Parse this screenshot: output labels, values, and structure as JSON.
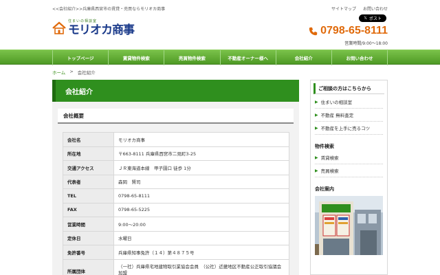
{
  "header": {
    "tagline": "<<会社紹介>>兵庫県西宮市の賃貸・売買ならモリオカ商事",
    "logo_sub": "住まいの相談室",
    "logo_main": "モリオカ商事",
    "links": [
      "サイトマップ",
      "お問い合わせ"
    ],
    "x_post": "ポスト",
    "phone": "0798-65-8111",
    "hours": "営業時間/9:00～18:00",
    "colors": {
      "accent_orange": "#e06a0b",
      "brand_green": "#2f8f1e"
    }
  },
  "nav": {
    "items": [
      "トップページ",
      "賃貸物件検索",
      "売買物件検索",
      "不動産オーナー様へ",
      "会社紹介",
      "お問い合わせ"
    ]
  },
  "breadcrumb": {
    "home": "ホーム",
    "sep": ">",
    "current": "会社紹介"
  },
  "main": {
    "title": "会社紹介",
    "section_title": "会社概要",
    "rows": [
      {
        "label": "会社名",
        "value": "モリオカ商事"
      },
      {
        "label": "所在地",
        "value": "〒663-8111 兵庫県西宮市二見町3-25"
      },
      {
        "label": "交通アクセス",
        "value": "ＪＲ東海道本線　甲子園口 徒歩 1分"
      },
      {
        "label": "代表者",
        "value": "森岡　賢司"
      },
      {
        "label": "TEL",
        "value": "0798-65-8111"
      },
      {
        "label": "FAX",
        "value": "0798-65-5225"
      },
      {
        "label": "営業時間",
        "value": "9:00～20:00"
      },
      {
        "label": "定休日",
        "value": "水曜日"
      },
      {
        "label": "免許番号",
        "value": "兵庫県知事免許（１４）第４８７５号"
      },
      {
        "label": "所属団体",
        "value": "（一社）兵庫県宅地建物取引業協会会員　（公社）近畿地区不動産公正取引協議会加盟"
      }
    ]
  },
  "sidebar": {
    "consult_head": "ご相談の方はこちらから",
    "consult_items": [
      "住まいの相談室",
      "不動産 無料査定",
      "不動産を上手に売るコツ"
    ],
    "search_title": "物件検索",
    "search_items": [
      "賃貸検索",
      "売買検索"
    ],
    "shop_title": "会社案内"
  }
}
